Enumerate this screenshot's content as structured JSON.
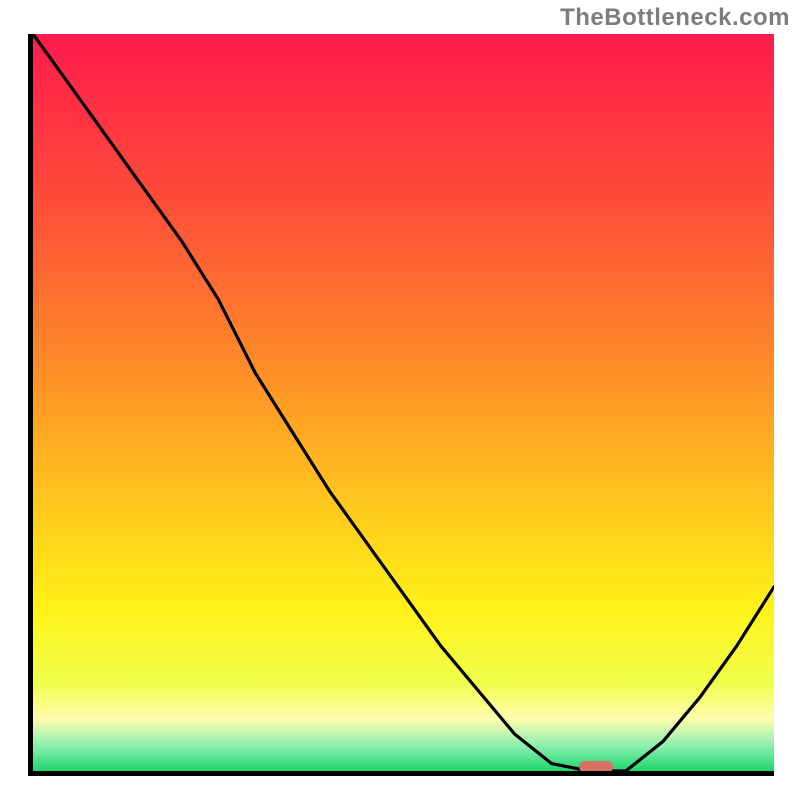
{
  "attribution": "TheBottleneck.com",
  "chart_data": {
    "type": "line",
    "title": "",
    "xlabel": "",
    "ylabel": "",
    "xlim": [
      0,
      100
    ],
    "ylim": [
      0,
      100
    ],
    "grid": false,
    "legend": false,
    "series": [
      {
        "name": "bottleneck-curve",
        "x": [
          0,
          5,
          10,
          15,
          20,
          25,
          30,
          35,
          40,
          45,
          50,
          55,
          60,
          65,
          70,
          75,
          80,
          85,
          90,
          95,
          100
        ],
        "y": [
          100,
          93,
          86,
          79,
          72,
          64,
          54,
          46,
          38,
          31,
          24,
          17,
          11,
          5,
          1,
          0,
          0,
          4,
          10,
          17,
          25
        ]
      }
    ],
    "marker": {
      "name": "optimal-point",
      "x": 76,
      "y": 0,
      "color": "#d97065",
      "shape": "capsule"
    },
    "gradient": {
      "stops": [
        {
          "offset": 0.0,
          "color": "#ff1a4c"
        },
        {
          "offset": 0.22,
          "color": "#ff4b3a"
        },
        {
          "offset": 0.45,
          "color": "#ff8c28"
        },
        {
          "offset": 0.62,
          "color": "#ffc21e"
        },
        {
          "offset": 0.78,
          "color": "#fff218"
        },
        {
          "offset": 0.88,
          "color": "#f0ff4a"
        },
        {
          "offset": 0.93,
          "color": "#fffcb0"
        },
        {
          "offset": 0.965,
          "color": "#8ef0b0"
        },
        {
          "offset": 1.0,
          "color": "#1fd66b"
        }
      ]
    }
  }
}
